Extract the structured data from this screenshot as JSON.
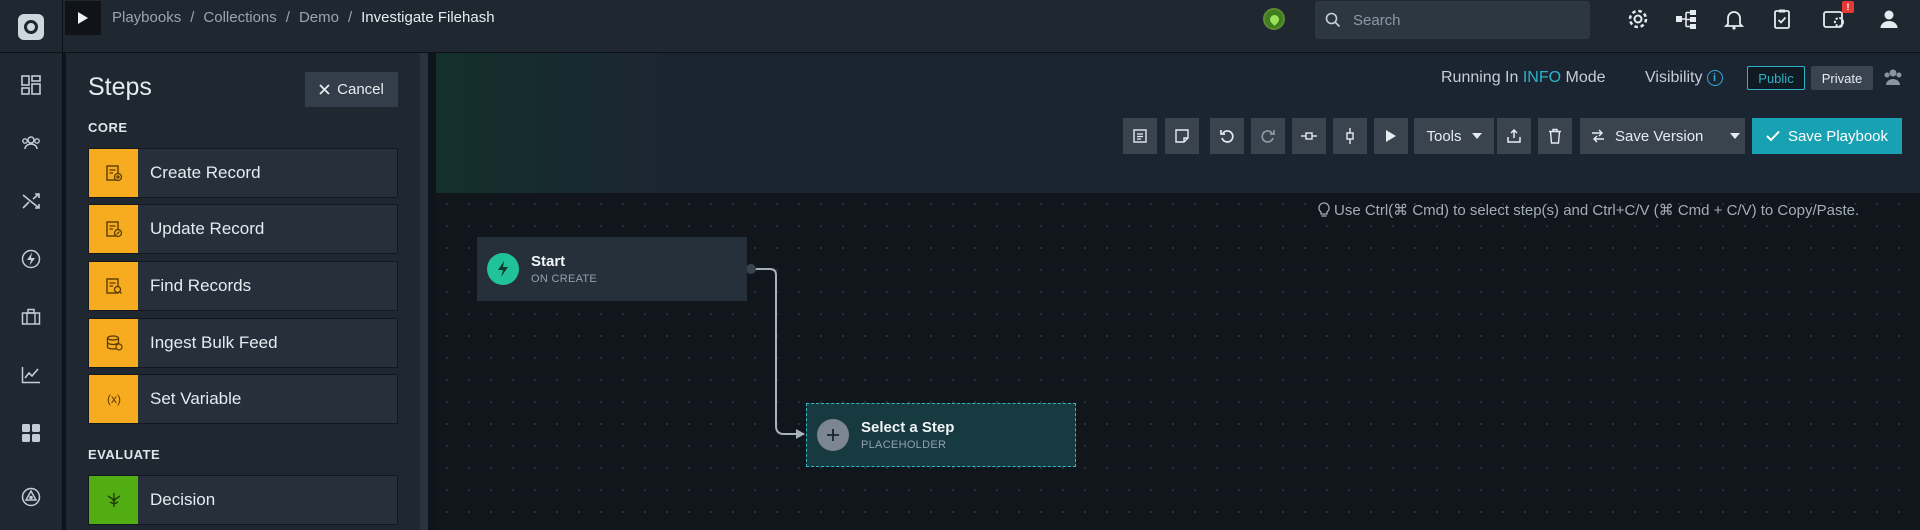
{
  "breadcrumb": {
    "items": [
      "Playbooks",
      "/",
      "Collections",
      "/",
      "Demo",
      "/"
    ],
    "current": "Investigate Filehash"
  },
  "search": {
    "placeholder": "Search",
    "value": ""
  },
  "steps_panel": {
    "title": "Steps",
    "cancel_label": "Cancel",
    "sections": [
      {
        "label": "CORE",
        "items": [
          "Create Record",
          "Update Record",
          "Find Records",
          "Ingest Bulk Feed",
          "Set Variable"
        ]
      },
      {
        "label": "EVALUATE",
        "items": [
          "Decision"
        ]
      }
    ]
  },
  "header": {
    "running_prefix": "Running In",
    "running_mode": "INFO",
    "running_suffix": "Mode",
    "visibility_label": "Visibility",
    "public_label": "Public",
    "private_label": "Private"
  },
  "toolbar": {
    "tools_label": "Tools",
    "save_version_label": "Save Version",
    "save_playbook_label": "Save Playbook"
  },
  "canvas": {
    "hint": "Use Ctrl(⌘ Cmd) to select step(s) and Ctrl+C/V (⌘ Cmd + C/V) to Copy/Paste.",
    "start_node": {
      "title": "Start",
      "subtitle": "ON CREATE"
    },
    "placeholder_node": {
      "title": "Select a Step",
      "subtitle": "PLACEHOLDER"
    }
  },
  "notifications": {
    "badge": "!"
  },
  "colors": {
    "accent": "#18a1b3",
    "core_step": "#f6ac1e",
    "evaluate_step": "#52ad13",
    "start_node": "#20c29a"
  },
  "icons": [
    "settings-icon",
    "sitemap-icon",
    "bell-icon",
    "clipboard-check-icon",
    "system-alert-icon",
    "user-icon",
    "dashboard-icon",
    "users-icon",
    "shuffle-icon",
    "bolt-icon",
    "briefcase-icon",
    "chart-icon",
    "apps-icon",
    "hub-icon"
  ]
}
